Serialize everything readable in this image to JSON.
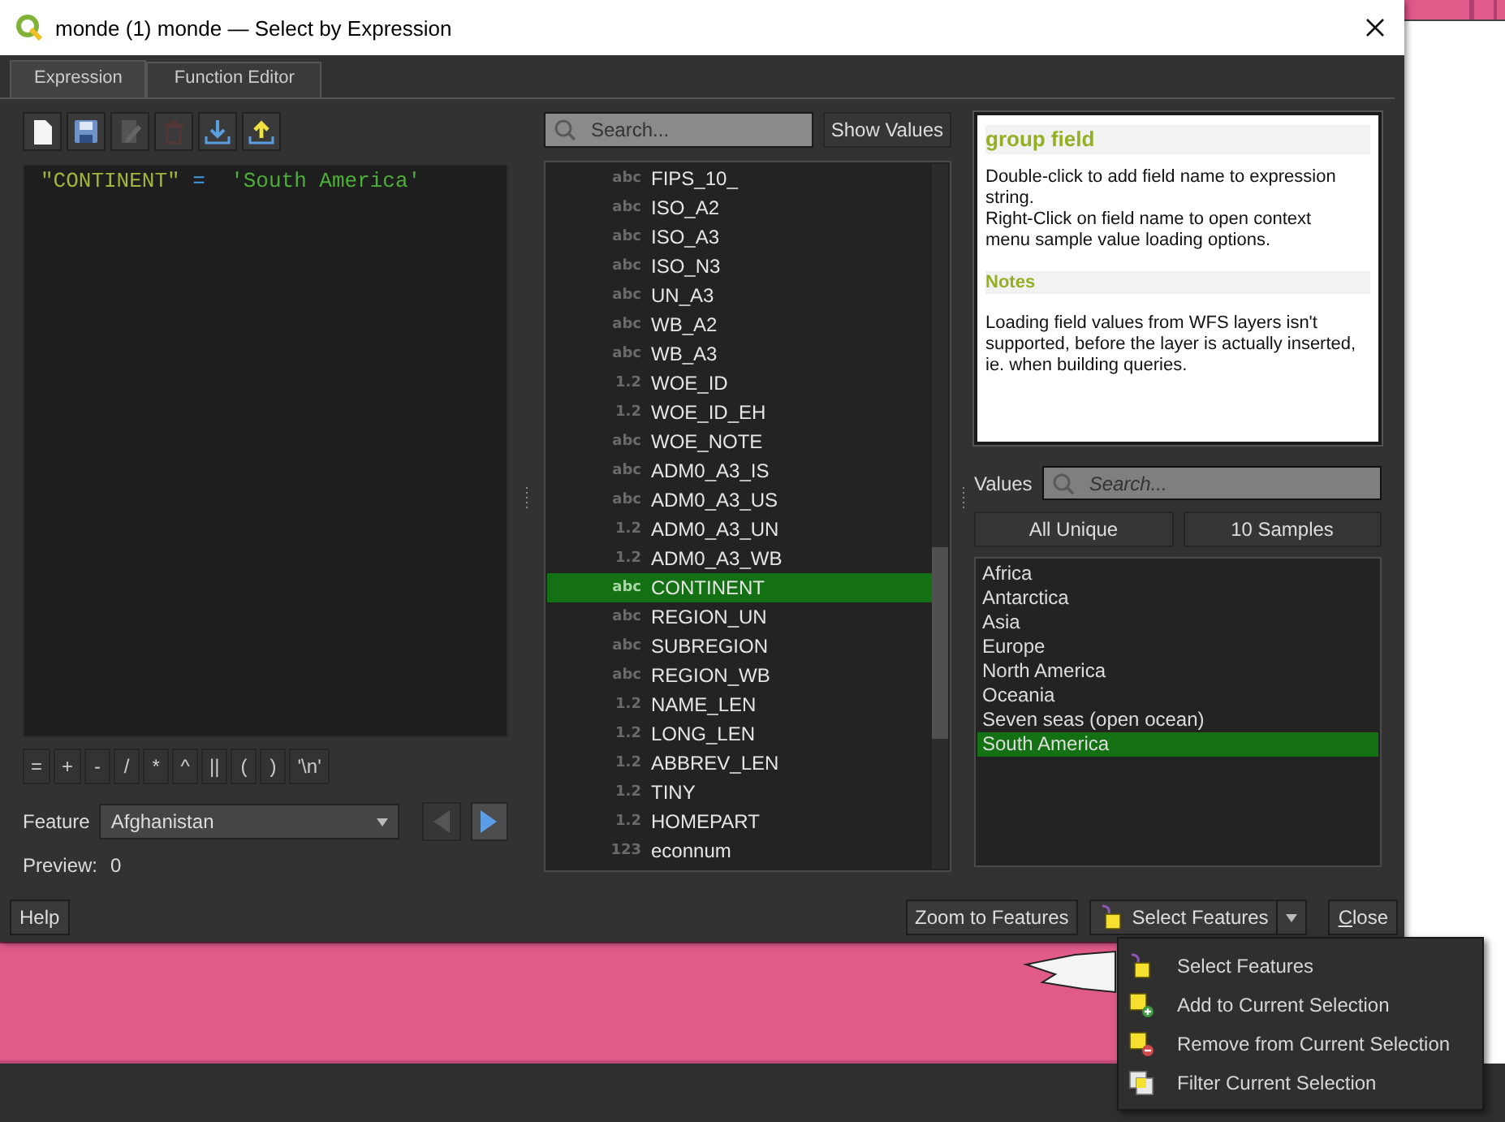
{
  "window": {
    "title": "monde (1) monde — Select by Expression"
  },
  "tabs": [
    {
      "label": "Expression",
      "selected": true
    },
    {
      "label": "Function Editor",
      "selected": false
    }
  ],
  "toolbar": [
    {
      "kind": "new",
      "disabled": false
    },
    {
      "kind": "save",
      "disabled": false
    },
    {
      "kind": "edit",
      "disabled": true
    },
    {
      "kind": "delete",
      "disabled": true
    },
    {
      "kind": "import",
      "disabled": false
    },
    {
      "kind": "export",
      "disabled": false
    }
  ],
  "expression": [
    {
      "kind": "field",
      "text": "\"CONTINENT\""
    },
    {
      "kind": "operator",
      "text": "="
    },
    {
      "kind": "string",
      "text": "'South America'"
    }
  ],
  "operators": [
    "=",
    "+",
    "-",
    "/",
    "*",
    "^",
    "||",
    "(",
    ")",
    "'\\n'"
  ],
  "feature": {
    "label": "Feature",
    "value": "Afghanistan",
    "previous_disabled": true,
    "next_disabled": false
  },
  "preview": {
    "label": "Preview:",
    "value": "0"
  },
  "field_search": {
    "placeholder": "Search..."
  },
  "show_values": "Show Values",
  "fields": [
    {
      "type": "abc",
      "name": "FIPS_10_",
      "selected": false
    },
    {
      "type": "abc",
      "name": "ISO_A2",
      "selected": false
    },
    {
      "type": "abc",
      "name": "ISO_A3",
      "selected": false
    },
    {
      "type": "abc",
      "name": "ISO_N3",
      "selected": false
    },
    {
      "type": "abc",
      "name": "UN_A3",
      "selected": false
    },
    {
      "type": "abc",
      "name": "WB_A2",
      "selected": false
    },
    {
      "type": "abc",
      "name": "WB_A3",
      "selected": false
    },
    {
      "type": "1.2",
      "name": "WOE_ID",
      "selected": false
    },
    {
      "type": "1.2",
      "name": "WOE_ID_EH",
      "selected": false
    },
    {
      "type": "abc",
      "name": "WOE_NOTE",
      "selected": false
    },
    {
      "type": "abc",
      "name": "ADM0_A3_IS",
      "selected": false
    },
    {
      "type": "abc",
      "name": "ADM0_A3_US",
      "selected": false
    },
    {
      "type": "1.2",
      "name": "ADM0_A3_UN",
      "selected": false
    },
    {
      "type": "1.2",
      "name": "ADM0_A3_WB",
      "selected": false
    },
    {
      "type": "abc",
      "name": "CONTINENT",
      "selected": true
    },
    {
      "type": "abc",
      "name": "REGION_UN",
      "selected": false
    },
    {
      "type": "abc",
      "name": "SUBREGION",
      "selected": false
    },
    {
      "type": "abc",
      "name": "REGION_WB",
      "selected": false
    },
    {
      "type": "1.2",
      "name": "NAME_LEN",
      "selected": false
    },
    {
      "type": "1.2",
      "name": "LONG_LEN",
      "selected": false
    },
    {
      "type": "1.2",
      "name": "ABBREV_LEN",
      "selected": false
    },
    {
      "type": "1.2",
      "name": "TINY",
      "selected": false
    },
    {
      "type": "1.2",
      "name": "HOMEPART",
      "selected": false
    },
    {
      "type": "123",
      "name": "econnum",
      "selected": false
    }
  ],
  "help": {
    "title": "group field",
    "paragraphs": [
      "Double-click to add field name to expression string.",
      "Right-Click on field name to open context menu sample value loading options."
    ],
    "notes_title": "Notes",
    "notes": "Loading field values from WFS layers isn't supported, before the layer is actually inserted, ie. when building queries."
  },
  "values": {
    "label": "Values",
    "placeholder": "Search...",
    "buttons": [
      "All Unique",
      "10 Samples"
    ],
    "items": [
      {
        "label": "Africa",
        "selected": false
      },
      {
        "label": "Antarctica",
        "selected": false
      },
      {
        "label": "Asia",
        "selected": false
      },
      {
        "label": "Europe",
        "selected": false
      },
      {
        "label": "North America",
        "selected": false
      },
      {
        "label": "Oceania",
        "selected": false
      },
      {
        "label": "Seven seas (open ocean)",
        "selected": false
      },
      {
        "label": "South America",
        "selected": true
      }
    ]
  },
  "buttons": {
    "help": "Help",
    "zoom": "Zoom to Features",
    "select": "Select Features",
    "close": "Close"
  },
  "menu": [
    {
      "kind": "select",
      "label": "Select Features"
    },
    {
      "kind": "add",
      "label": "Add to Current Selection"
    },
    {
      "kind": "remove",
      "label": "Remove from Current Selection"
    },
    {
      "kind": "filter",
      "label": "Filter Current Selection"
    }
  ]
}
